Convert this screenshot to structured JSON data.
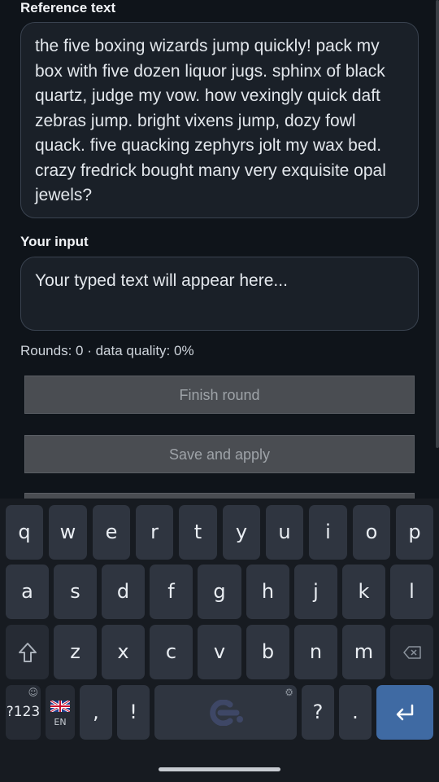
{
  "reference": {
    "label": "Reference text",
    "text": "the five boxing wizards jump quickly! pack my box with five dozen liquor jugs. sphinx of black quartz, judge my vow. how vexingly quick daft zebras jump. bright vixens jump, dozy fowl quack. five quacking zephyrs jolt my wax bed. crazy fredrick bought many very exquisite opal jewels?"
  },
  "input": {
    "label": "Your input",
    "placeholder": "Your typed text will appear here..."
  },
  "stats": "Rounds: 0 · data quality: 0%",
  "buttons": {
    "finish_label": "Finish round",
    "save_label": "Save and apply"
  },
  "keyboard": {
    "row1": [
      "q",
      "w",
      "e",
      "r",
      "t",
      "y",
      "u",
      "i",
      "o",
      "p"
    ],
    "row2": [
      "a",
      "s",
      "d",
      "f",
      "g",
      "h",
      "j",
      "k",
      "l"
    ],
    "row3": [
      "z",
      "x",
      "c",
      "v",
      "b",
      "n",
      "m"
    ],
    "shift_icon": "shift-arrow-icon",
    "backspace_icon": "backspace-icon",
    "symbols_label": "?123",
    "lang_label": "EN",
    "comma": ",",
    "exclaim": "!",
    "question": "?",
    "period": ".",
    "enter_icon": "enter-arrow-icon",
    "emoji_icon": "emoji-icon",
    "settings_icon": "gear-icon",
    "flag_icon": "uk-flag-icon",
    "space_logo_icon": "keyboard-logo-icon",
    "colors": {
      "enter_key": "#3f6aa3",
      "key": "#2f3540",
      "background": "#171b21"
    }
  }
}
